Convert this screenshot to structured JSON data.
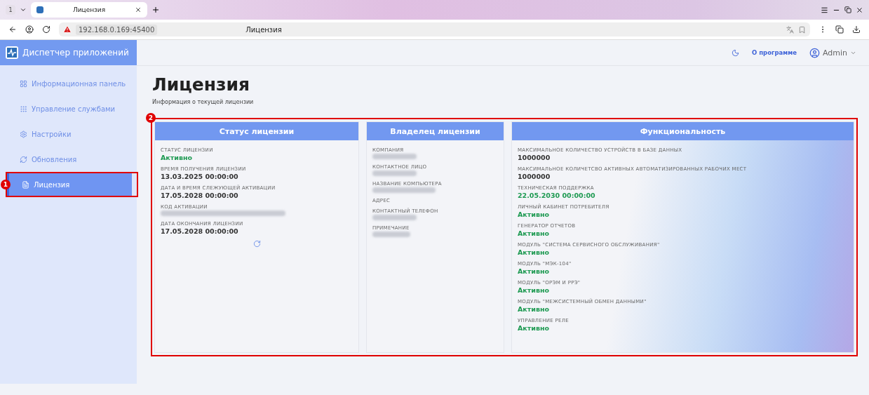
{
  "browser": {
    "tab_count": "1",
    "tab_title": "Лицензия",
    "address": "192.168.0.169:45400",
    "page_title": "Лицензия"
  },
  "app": {
    "title": "Диспетчер приложений",
    "about_link": "О программе",
    "user": "Admin"
  },
  "sidebar": {
    "items": [
      {
        "label": "Информационная панель",
        "selected": false
      },
      {
        "label": "Управление службами",
        "selected": false
      },
      {
        "label": "Настройки",
        "selected": false
      },
      {
        "label": "Обновления",
        "selected": false
      },
      {
        "label": "Лицензия",
        "selected": true,
        "callout": "1"
      }
    ]
  },
  "page": {
    "title": "Лицензия",
    "subtitle": "Информация о текущей лицензии",
    "cards_callout": "2"
  },
  "cards": [
    {
      "title": "Статус лицензии",
      "refresh": true,
      "fields": [
        {
          "label": "СТАТУС ЛИЦЕНЗИИ",
          "kind": "active",
          "value": "Активно"
        },
        {
          "label": "ВРЕМЯ ПОЛУЧЕНИЯ ЛИЦЕНЗИИ",
          "kind": "text",
          "value": "13.03.2025 00:00:00"
        },
        {
          "label": "ДАТА И ВРЕМЯ СЛЕЖУЮЩЕЙ АКТИВАЦИИ",
          "kind": "text",
          "value": "17.05.2028 00:00:00"
        },
        {
          "label": "КОД АКТИВАЦИИ",
          "kind": "redacted"
        },
        {
          "label": "ДАТА ОКОНЧАНИЯ ЛИЦЕНЗИИ",
          "kind": "text",
          "value": "17.05.2028 00:00:00"
        }
      ]
    },
    {
      "title": "Владелец лицензии",
      "refresh": false,
      "fields": [
        {
          "label": "КОМПАНИЯ",
          "kind": "redacted"
        },
        {
          "label": "КОНТАКТНОЕ ЛИЦО",
          "kind": "redacted"
        },
        {
          "label": "НАЗВАНИЕ КОМПЬЮТЕРА",
          "kind": "redacted"
        },
        {
          "label": "АДРЕС",
          "kind": "empty"
        },
        {
          "label": "КОНТАКТНЫЙ ТЕЛЕФОН",
          "kind": "redacted"
        },
        {
          "label": "ПРИМЕЧАНИЕ",
          "kind": "redacted"
        }
      ]
    },
    {
      "title": "Функциональность",
      "refresh": false,
      "fields": [
        {
          "label": "МАКСИМАЛЬНОЕ КОЛИЧЕСТВО УСТРОЙСТВ В БАЗЕ ДАННЫХ",
          "kind": "text",
          "value": "1000000"
        },
        {
          "label": "МАКСИМАЛЬНОЕ КОЛИЧЕТСВО АКТИВНЫХ АВТОМАТИЗИРОВАННЫХ РАБОЧИХ МЕСТ",
          "kind": "text",
          "value": "1000000"
        },
        {
          "label": "ТЕХНИЧЕСКАЯ ПОДДЕРЖКА",
          "kind": "active",
          "value": "22.05.2030 00:00:00"
        },
        {
          "label": "ЛИЧНЫЙ КАБИНЕТ ПОТРЕБИТЕЛЯ",
          "kind": "active",
          "value": "Активно"
        },
        {
          "label": "ГЕНЕРАТОР ОТЧЕТОВ",
          "kind": "active",
          "value": "Активно"
        },
        {
          "label": "МОДУЛЬ \"СИСТЕМА СЕРВИСНОГО ОБСЛУЖИВАНИЯ\"",
          "kind": "active",
          "value": "Активно"
        },
        {
          "label": "МОДУЛЬ \"МЭК-104\"",
          "kind": "active",
          "value": "Активно"
        },
        {
          "label": "МОДУЛЬ \"ОРЭМ И РРЭ\"",
          "kind": "active",
          "value": "Активно"
        },
        {
          "label": "МОДУЛЬ \"МЕЖСИСТЕМНЫЙ ОБМЕН ДАННЫМИ\"",
          "kind": "active",
          "value": "Активно"
        },
        {
          "label": "УПРАВЛЕНИЕ РЕЛЕ",
          "kind": "active",
          "value": "Активно"
        }
      ]
    }
  ]
}
